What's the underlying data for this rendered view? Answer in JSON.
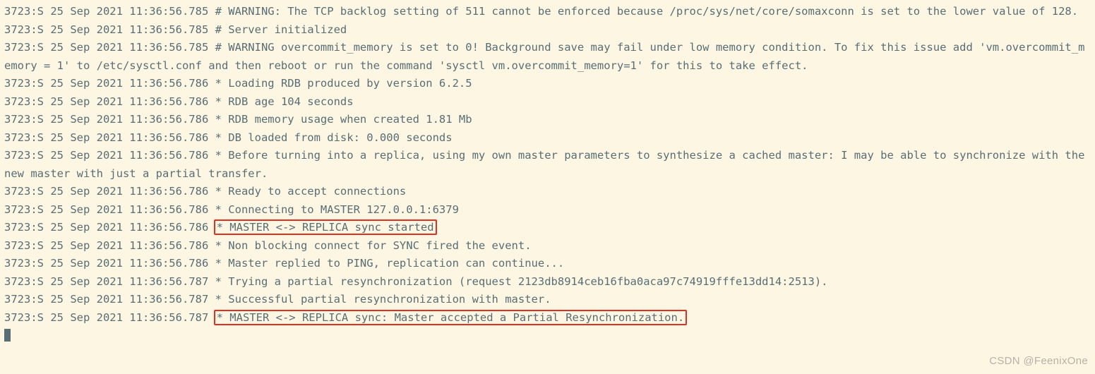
{
  "lines": [
    {
      "prefix": "3723:S 25 Sep 2021 11:36:56.785 ",
      "msg": "# WARNING: The TCP backlog setting of 511 cannot be enforced because /proc/sys/net/core/somaxconn is set to the lower value of 128.",
      "hl": false
    },
    {
      "prefix": "3723:S 25 Sep 2021 11:36:56.785 ",
      "msg": "# Server initialized",
      "hl": false
    },
    {
      "prefix": "3723:S 25 Sep 2021 11:36:56.785 ",
      "msg": "# WARNING overcommit_memory is set to 0! Background save may fail under low memory condition. To fix this issue add 'vm.overcommit_memory = 1' to /etc/sysctl.conf and then reboot or run the command 'sysctl vm.overcommit_memory=1' for this to take effect.",
      "hl": false
    },
    {
      "prefix": "3723:S 25 Sep 2021 11:36:56.786 ",
      "msg": "* Loading RDB produced by version 6.2.5",
      "hl": false
    },
    {
      "prefix": "3723:S 25 Sep 2021 11:36:56.786 ",
      "msg": "* RDB age 104 seconds",
      "hl": false
    },
    {
      "prefix": "3723:S 25 Sep 2021 11:36:56.786 ",
      "msg": "* RDB memory usage when created 1.81 Mb",
      "hl": false
    },
    {
      "prefix": "3723:S 25 Sep 2021 11:36:56.786 ",
      "msg": "* DB loaded from disk: 0.000 seconds",
      "hl": false
    },
    {
      "prefix": "3723:S 25 Sep 2021 11:36:56.786 ",
      "msg": "* Before turning into a replica, using my own master parameters to synthesize a cached master: I may be able to synchronize with the new master with just a partial transfer.",
      "hl": false
    },
    {
      "prefix": "3723:S 25 Sep 2021 11:36:56.786 ",
      "msg": "* Ready to accept connections",
      "hl": false
    },
    {
      "prefix": "3723:S 25 Sep 2021 11:36:56.786 ",
      "msg": "* Connecting to MASTER 127.0.0.1:6379",
      "hl": false
    },
    {
      "prefix": "3723:S 25 Sep 2021 11:36:56.786 ",
      "msg": "* MASTER <-> REPLICA sync started",
      "hl": true
    },
    {
      "prefix": "3723:S 25 Sep 2021 11:36:56.786 ",
      "msg": "* Non blocking connect for SYNC fired the event.",
      "hl": false
    },
    {
      "prefix": "3723:S 25 Sep 2021 11:36:56.786 ",
      "msg": "* Master replied to PING, replication can continue...",
      "hl": false
    },
    {
      "prefix": "3723:S 25 Sep 2021 11:36:56.787 ",
      "msg": "* Trying a partial resynchronization (request 2123db8914ceb16fba0aca97c74919fffe13dd14:2513).",
      "hl": false
    },
    {
      "prefix": "3723:S 25 Sep 2021 11:36:56.787 ",
      "msg": "* Successful partial resynchronization with master.",
      "hl": false
    },
    {
      "prefix": "3723:S 25 Sep 2021 11:36:56.787 ",
      "msg": "* MASTER <-> REPLICA sync: Master accepted a Partial Resynchronization.",
      "hl": true
    }
  ],
  "watermark": "CSDN @FeenixOne"
}
